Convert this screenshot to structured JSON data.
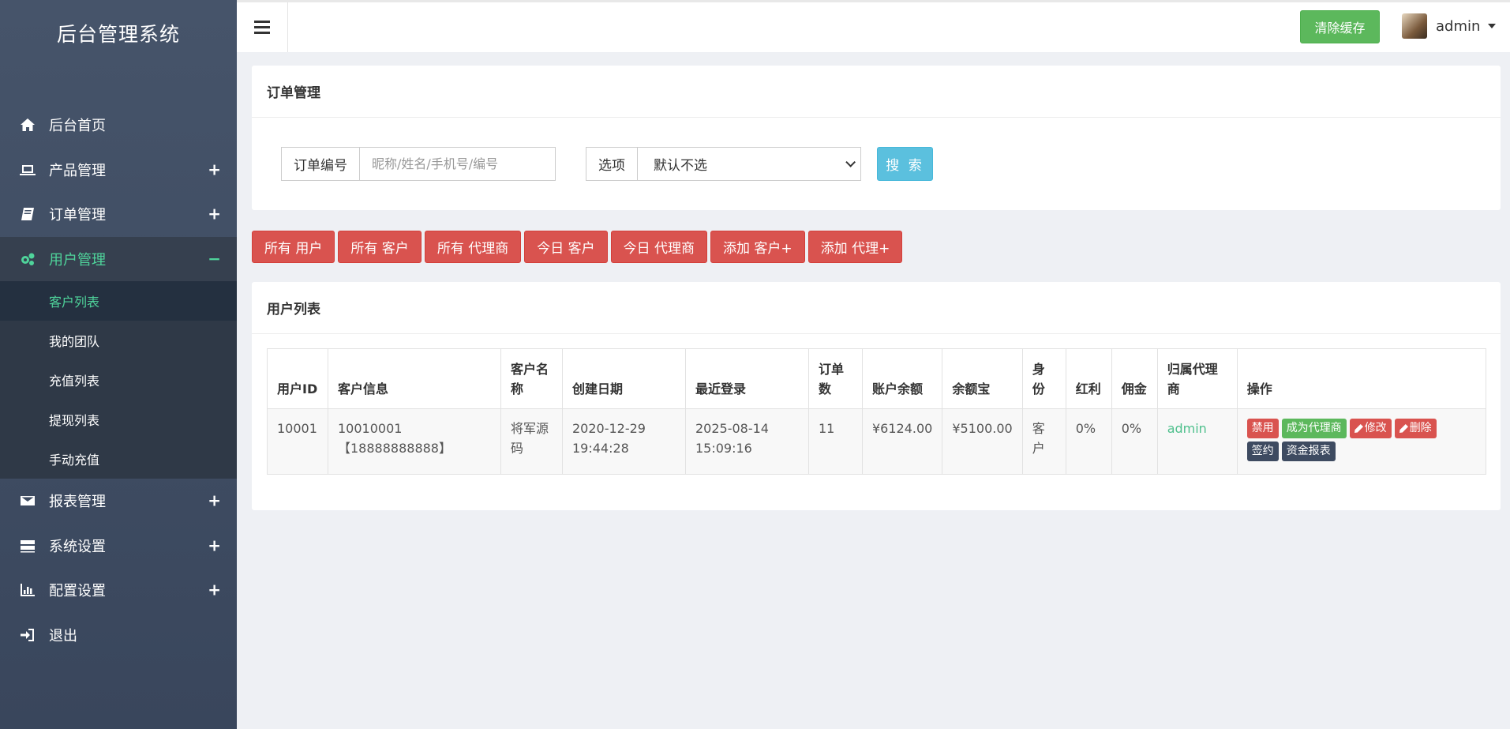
{
  "app": {
    "title": "后台管理系统"
  },
  "sidebar": {
    "items": [
      {
        "label": "后台首页",
        "icon": "home-icon"
      },
      {
        "label": "产品管理",
        "icon": "laptop-icon",
        "toggle": "+"
      },
      {
        "label": "订单管理",
        "icon": "book-icon",
        "toggle": "+"
      },
      {
        "label": "用户管理",
        "icon": "gears-icon",
        "toggle": "−",
        "active": true
      },
      {
        "label": "报表管理",
        "icon": "envelope-icon",
        "toggle": "+"
      },
      {
        "label": "系统设置",
        "icon": "server-icon",
        "toggle": "+"
      },
      {
        "label": "配置设置",
        "icon": "bar-chart-icon",
        "toggle": "+"
      },
      {
        "label": "退出",
        "icon": "sign-in-icon"
      }
    ],
    "sub_items": [
      {
        "label": "客户列表",
        "active": true
      },
      {
        "label": "我的团队"
      },
      {
        "label": "充值列表"
      },
      {
        "label": "提现列表"
      },
      {
        "label": "手动充值"
      }
    ]
  },
  "topbar": {
    "clear_cache_label": "清除缓存",
    "user_name": "admin"
  },
  "search_panel": {
    "title": "订单管理",
    "order_no_label": "订单编号",
    "search_placeholder": "昵称/姓名/手机号/编号",
    "option_label": "选项",
    "option_selected": "默认不选",
    "search_button": "搜 索"
  },
  "filters": [
    "所有 用户",
    "所有 客户",
    "所有 代理商",
    "今日 客户",
    "今日 代理商",
    "添加 客户+",
    "添加 代理+"
  ],
  "user_table": {
    "title": "用户列表",
    "headers": [
      "用户ID",
      "客户信息",
      "客户名称",
      "创建日期",
      "最近登录",
      "订单数",
      "账户余额",
      "余额宝",
      "身份",
      "红利",
      "佣金",
      "归属代理商",
      "操作"
    ],
    "rows": [
      {
        "id": "10001",
        "info_line1": "10010001",
        "info_line2": "【18888888888】",
        "name": "将军源码",
        "created": "2020-12-29 19:44:28",
        "last_login": "2025-08-14 15:09:16",
        "orders": "11",
        "balance": "¥6124.00",
        "yuebao": "¥5100.00",
        "role": "客户",
        "bonus": "0%",
        "commission": "0%",
        "agent": "admin",
        "actions": {
          "disable": "禁用",
          "make_agent": "成为代理商",
          "edit": "修改",
          "delete": "删除",
          "sign": "签约",
          "fund_report": "资金报表"
        }
      }
    ]
  },
  "colors": {
    "sidebar_bg": "#3c4b64",
    "accent_green": "#4fd49b",
    "danger": "#d9534f",
    "success": "#5cb85c",
    "info": "#5bc0de",
    "dark_btn": "#3e4b61"
  }
}
